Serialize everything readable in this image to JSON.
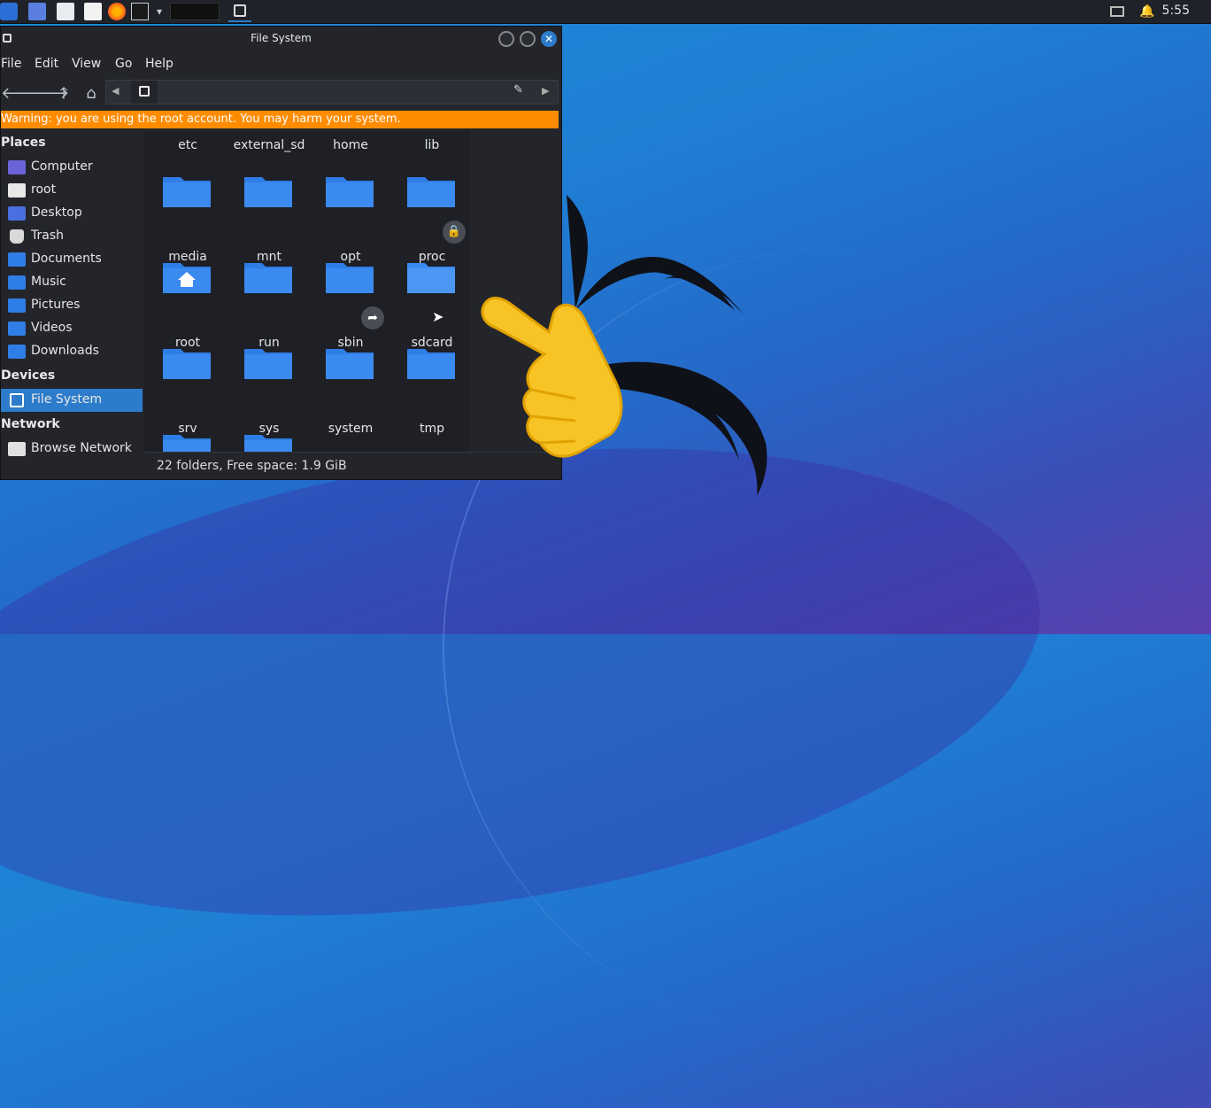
{
  "panel": {
    "clock": "5:55"
  },
  "window": {
    "title": "File System",
    "menu": [
      "File",
      "Edit",
      "View",
      "Go",
      "Help"
    ],
    "warning": "Warning: you are using the root account. You may harm your system.",
    "status": "22 folders, Free space: 1.9 GiB"
  },
  "sidebar": {
    "places_header": "Places",
    "places": [
      "Computer",
      "root",
      "Desktop",
      "Trash",
      "Documents",
      "Music",
      "Pictures",
      "Videos",
      "Downloads"
    ],
    "devices_header": "Devices",
    "devices": [
      "File System"
    ],
    "network_header": "Network",
    "network": [
      "Browse Network"
    ]
  },
  "folders": {
    "row0": [
      "etc",
      "external_sd",
      "home",
      "lib"
    ],
    "row1": [
      "media",
      "mnt",
      "opt",
      "proc"
    ],
    "row2": [
      "root",
      "run",
      "sbin",
      "sdcard"
    ],
    "row3": [
      "srv",
      "sys",
      "system",
      "tmp"
    ]
  },
  "icons": {
    "panel": [
      "kali-menu-icon",
      "workspace-icon",
      "file-manager-icon",
      "text-editor-icon",
      "firefox-icon",
      "terminal-icon"
    ],
    "colors": {
      "folder": "#2f7de6",
      "accent": "#2d7ccb",
      "warning": "#ff8c00"
    }
  }
}
